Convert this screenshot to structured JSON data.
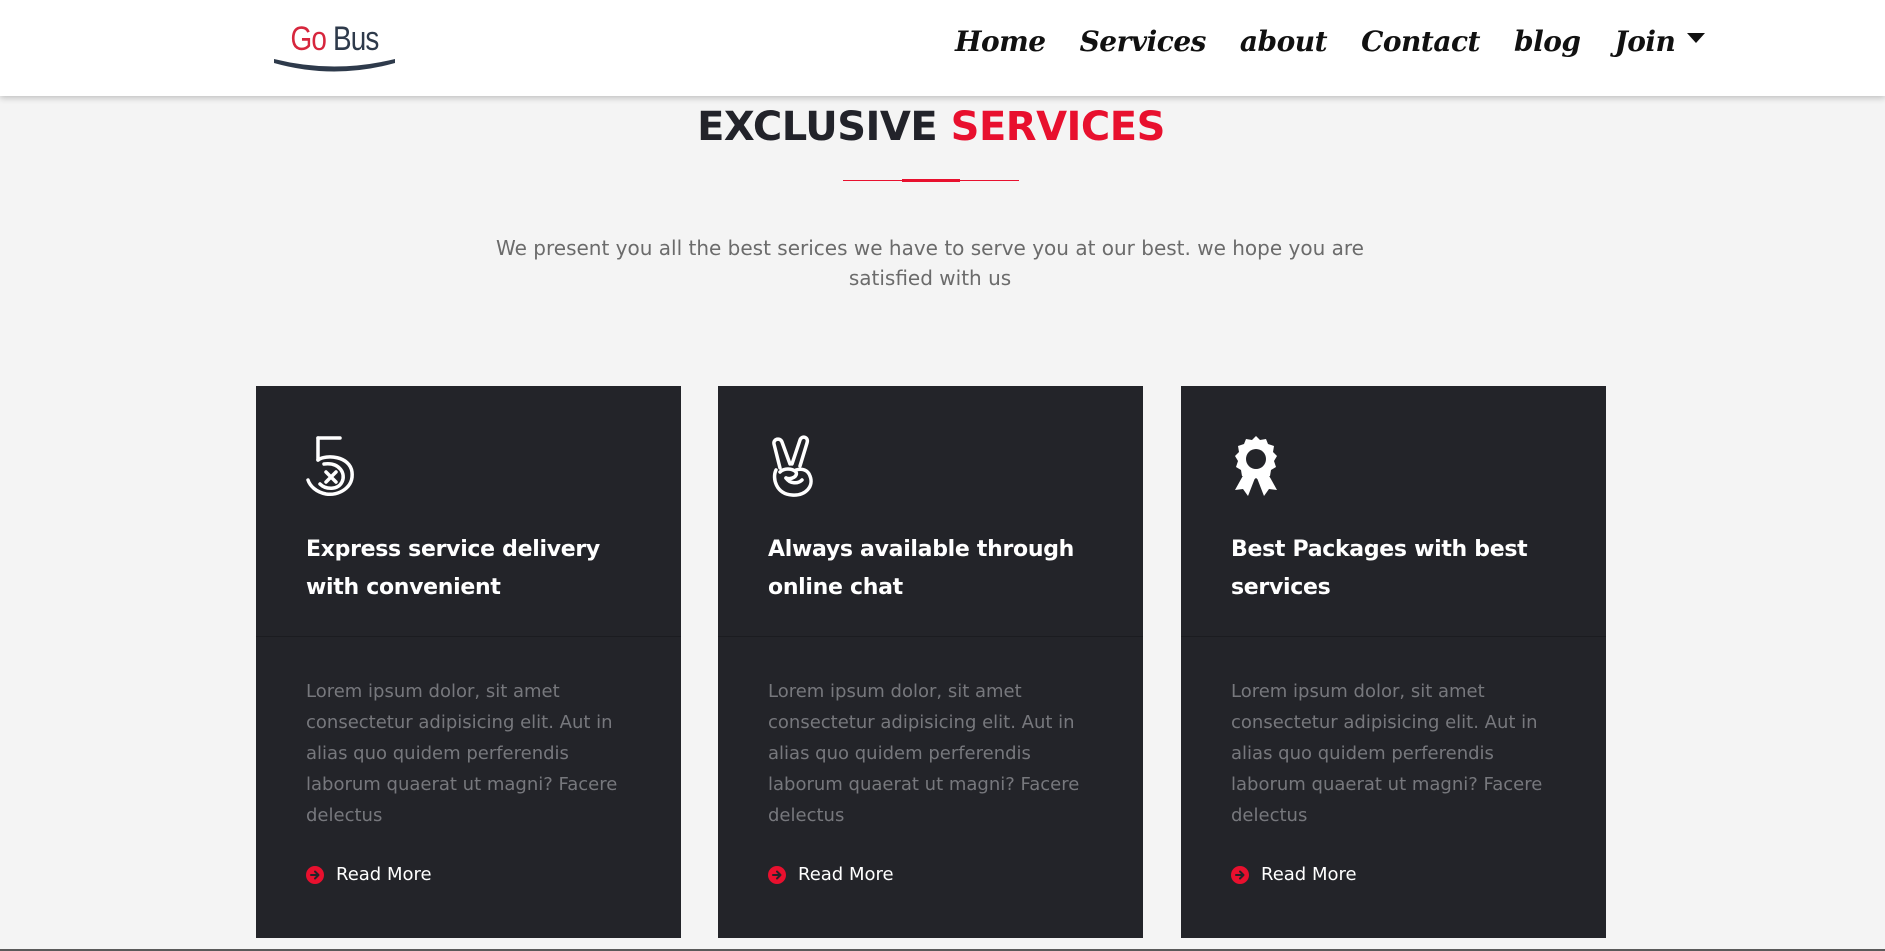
{
  "header": {
    "logo": {
      "go": "Go",
      "bus": "Bus"
    },
    "nav": [
      {
        "label": "Home"
      },
      {
        "label": "Services"
      },
      {
        "label": "about"
      },
      {
        "label": "Contact"
      },
      {
        "label": "blog"
      },
      {
        "label": "Join",
        "has_dropdown": true
      }
    ]
  },
  "section": {
    "title_dark": "EXCLUSIVE",
    "title_red": "SERVICES",
    "intro": "We present you all the best serices we have to serve you at our best. we hope you are satisfied with us"
  },
  "cards": [
    {
      "icon": "five-hand-icon",
      "title": "Express service delivery with convenient",
      "text": "Lorem ipsum dolor, sit amet consectetur adipisicing elit. Aut in alias quo quidem perferendis laborum quaerat ut magni? Facere delectus",
      "link": "Read More"
    },
    {
      "icon": "peace-hand-icon",
      "title": "Always available through online chat",
      "text": "Lorem ipsum dolor, sit amet consectetur adipisicing elit. Aut in alias quo quidem perferendis laborum quaerat ut magni? Facere delectus",
      "link": "Read More"
    },
    {
      "icon": "award-ribbon-icon",
      "title": "Best Packages with best services",
      "text": "Lorem ipsum dolor, sit amet consectetur adipisicing elit. Aut in alias quo quidem perferendis laborum quaerat ut magni? Facere delectus",
      "link": "Read More"
    }
  ],
  "colors": {
    "accent": "#e8102e",
    "card_bg": "#232429",
    "page_bg": "#f4f4f4",
    "logo_red": "#d7263d",
    "logo_dark": "#2e3a4b"
  }
}
